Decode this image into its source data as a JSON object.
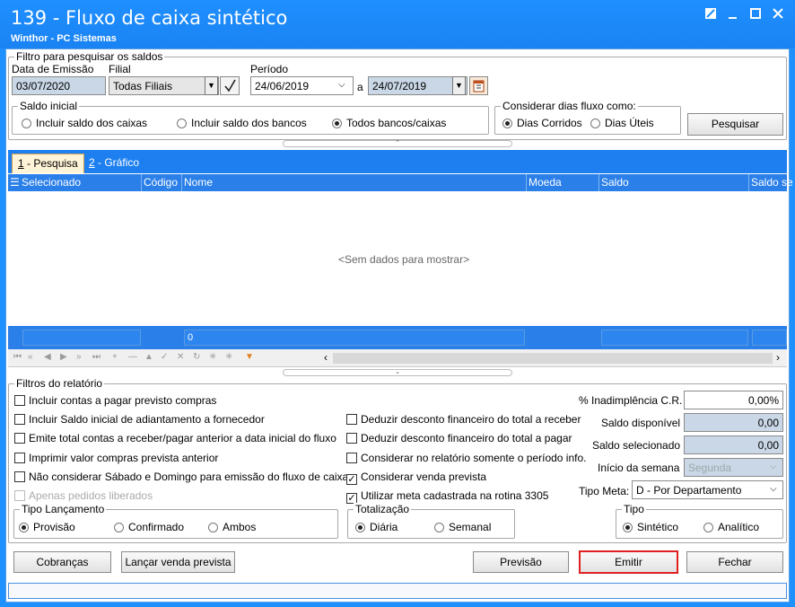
{
  "window": {
    "title": "139 - Fluxo de caixa sintético",
    "subtitle": "Winthor - PC Sistemas"
  },
  "filtro": {
    "group_label": "Filtro para pesquisar os saldos",
    "data_emissao_label": "Data de Emissão",
    "data_emissao_value": "03/07/2020",
    "filial_label": "Filial",
    "filial_value": "Todas Filiais",
    "periodo_label": "Período",
    "periodo_inicio": "24/06/2019",
    "periodo_sep": "a",
    "periodo_fim": "24/07/2019",
    "saldo_inicial_label": "Saldo inicial",
    "saldo_opcoes": [
      "Incluir saldo dos caixas",
      "Incluir saldo dos bancos",
      "Todos bancos/caixas"
    ],
    "saldo_selecionado": 2,
    "dias_label": "Considerar dias fluxo como:",
    "dias_opcoes": [
      "Dias Corridos",
      "Dias Úteis"
    ],
    "dias_selecionado": 0,
    "pesquisar_label": "Pesquisar"
  },
  "tabs": [
    {
      "num": "1",
      "label": " - Pesquisa"
    },
    {
      "num": "2",
      "label": " - Gráfico"
    }
  ],
  "grid": {
    "columns": [
      "Selecionado",
      "Código",
      "Nome",
      "Moeda",
      "Saldo",
      "Saldo se"
    ],
    "empty_text": "<Sem dados para mostrar>",
    "footer_value": "0"
  },
  "relatorio": {
    "group_label": "Filtros do relatório",
    "checks_left": [
      {
        "label": "Incluir contas a pagar previsto compras",
        "checked": false,
        "disabled": false
      },
      {
        "label": "Incluir Saldo inicial de adiantamento a fornecedor",
        "checked": false,
        "disabled": false
      },
      {
        "label": "Emite total contas a receber/pagar anterior a data inicial do fluxo",
        "checked": false,
        "disabled": false
      },
      {
        "label": "Imprimir valor compras prevista anterior",
        "checked": false,
        "disabled": false
      },
      {
        "label": "Não considerar Sábado e Domingo para emissão do fluxo de caixa",
        "checked": false,
        "disabled": false
      },
      {
        "label": "Apenas pedidos liberados",
        "checked": false,
        "disabled": true
      }
    ],
    "checks_mid": [
      {
        "label": "Deduzir desconto financeiro do total a receber",
        "checked": false
      },
      {
        "label": "Deduzir desconto financeiro do total a pagar",
        "checked": false
      },
      {
        "label": "Considerar no relatório somente o período info.",
        "checked": false
      },
      {
        "label": "Considerar venda prevista",
        "checked": true
      },
      {
        "label": "Utilizar meta cadastrada na rotina 3305",
        "checked": true
      }
    ],
    "inadimplencia_label": "% Inadimplência C.R.",
    "inadimplencia_value": "0,00%",
    "saldo_disp_label": "Saldo disponível",
    "saldo_disp_value": "0,00",
    "saldo_sel_label": "Saldo selecionado",
    "saldo_sel_value": "0,00",
    "inicio_semana_label": "Início da semana",
    "inicio_semana_value": "Segunda",
    "tipo_meta_label": "Tipo Meta:",
    "tipo_meta_value": "D - Por Departamento",
    "tipo_lanc_label": "Tipo Lançamento",
    "tipo_lanc_opcoes": [
      "Provisão",
      "Confirmado",
      "Ambos"
    ],
    "tipo_lanc_sel": 0,
    "totalizacao_label": "Totalização",
    "totalizacao_opcoes": [
      "Diária",
      "Semanal"
    ],
    "totalizacao_sel": 0,
    "tipo_label": "Tipo",
    "tipo_opcoes": [
      "Sintético",
      "Analítico"
    ],
    "tipo_sel": 0
  },
  "buttons": {
    "cobrancas": "Cobranças",
    "lancar": "Lançar venda prevista",
    "previsao": "Previsão",
    "emitir": "Emitir",
    "fechar": "Fechar"
  },
  "colors": {
    "title_blue": "#1f8fff",
    "highlight_red": "#e02020"
  }
}
